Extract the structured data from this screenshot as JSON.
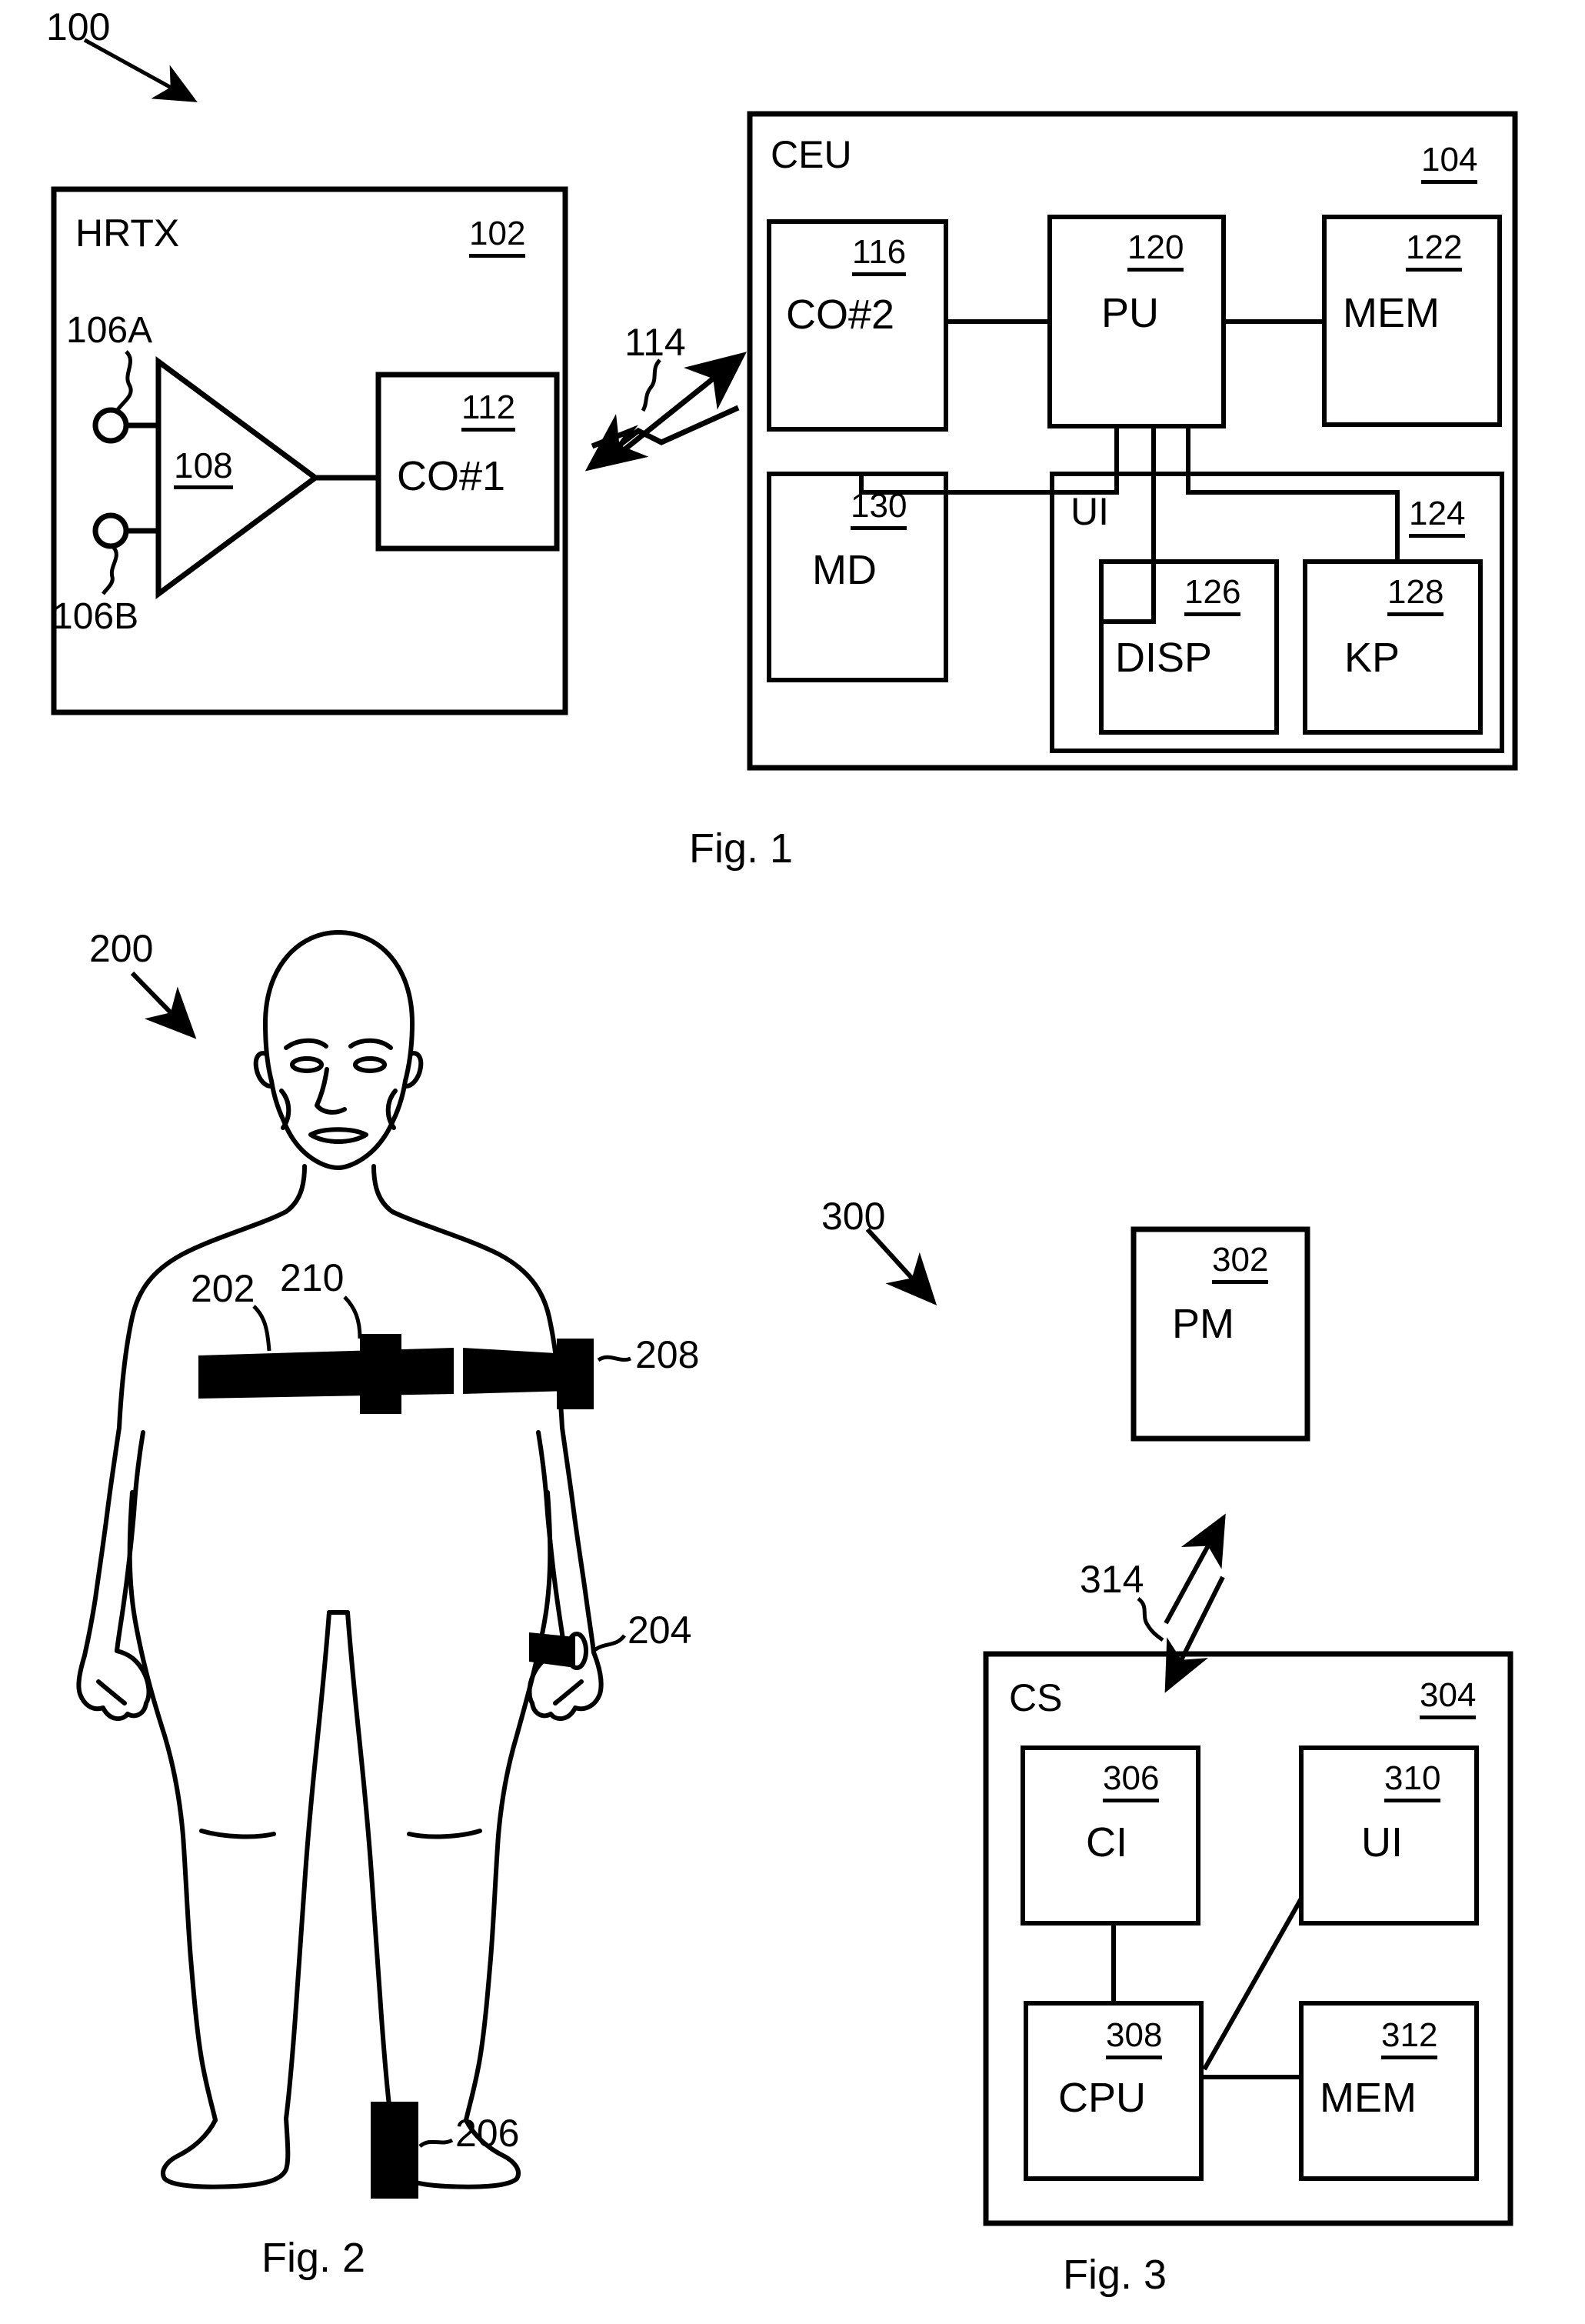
{
  "document": {
    "kind": "patent-drawing-sheet",
    "figures": [
      {
        "caption": "Fig. 1"
      },
      {
        "caption": "Fig. 2"
      },
      {
        "caption": "Fig. 3"
      }
    ]
  },
  "fig1": {
    "caption": "Fig. 1",
    "system_ref": "100",
    "link_ref": "114",
    "hrtx": {
      "title": "HRTX",
      "ref": "102",
      "electrode_a": "106A",
      "electrode_b": "106B",
      "amplifier_ref": "108",
      "co1": {
        "name": "CO#1",
        "ref": "112"
      }
    },
    "ceu": {
      "title": "CEU",
      "ref": "104",
      "blocks": [
        {
          "name": "CO#2",
          "ref": "116"
        },
        {
          "name": "PU",
          "ref": "120"
        },
        {
          "name": "MEM",
          "ref": "122"
        },
        {
          "name": "MD",
          "ref": "130"
        },
        {
          "name": "DISP",
          "ref": "126"
        },
        {
          "name": "KP",
          "ref": "128"
        }
      ],
      "ui": {
        "title": "UI",
        "ref": "124"
      }
    }
  },
  "fig2": {
    "caption": "Fig. 2",
    "subject_ref": "200",
    "items": [
      {
        "ref": "202",
        "description": "chest-strap"
      },
      {
        "ref": "210",
        "description": "strap-module"
      },
      {
        "ref": "208",
        "description": "arm-band-unit"
      },
      {
        "ref": "204",
        "description": "wrist-unit"
      },
      {
        "ref": "206",
        "description": "ankle-unit"
      }
    ]
  },
  "fig3": {
    "caption": "Fig. 3",
    "system_ref": "300",
    "link_ref": "314",
    "pm": {
      "name": "PM",
      "ref": "302"
    },
    "cs": {
      "title": "CS",
      "ref": "304",
      "blocks": [
        {
          "name": "CI",
          "ref": "306"
        },
        {
          "name": "UI",
          "ref": "310"
        },
        {
          "name": "CPU",
          "ref": "308"
        },
        {
          "name": "MEM",
          "ref": "312"
        }
      ]
    }
  },
  "colors": {
    "ink": "#000000",
    "paper": "#ffffff"
  }
}
